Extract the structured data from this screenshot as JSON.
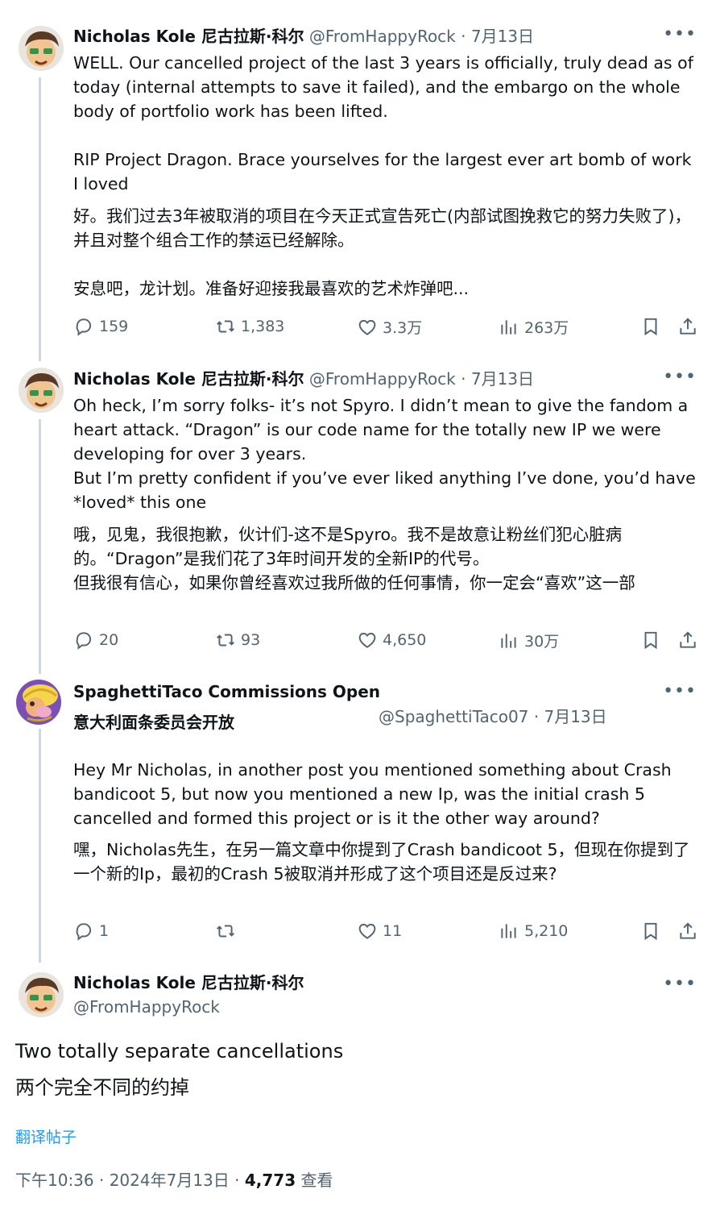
{
  "tweets": [
    {
      "author_name": "Nicholas Kole 尼古拉斯·科尔",
      "handle": "@FromHappyRock",
      "sep": "·",
      "date": "7月13日",
      "text_en": "WELL. Our cancelled project of the last 3 years is officially, truly dead as of today (internal attempts to save it failed), and the embargo on the whole body of portfolio work has been lifted.\n\nRIP Project Dragon. Brace yourselves for the largest ever art bomb of work I loved",
      "text_zh": "好。我们过去3年被取消的项目在今天正式宣告死亡(内部试图挽救它的努力失败了)，并且对整个组合工作的禁运已经解除。\n\n安息吧，龙计划。准备好迎接我最喜欢的艺术炸弹吧...",
      "replies": "159",
      "reposts": "1,383",
      "likes": "3.3万",
      "views": "263万"
    },
    {
      "author_name": "Nicholas Kole 尼古拉斯·科尔",
      "handle": "@FromHappyRock",
      "sep": "·",
      "date": "7月13日",
      "text_en": "Oh heck, I’m sorry folks- it’s not Spyro. I didn’t mean to give the fandom a heart attack. “Dragon” is our code name for the totally new IP we were developing for over 3 years.\nBut I’m pretty confident if you’ve ever liked anything I’ve done, you’d have *loved* this one",
      "text_zh": "哦，见鬼，我很抱歉，伙计们-这不是Spyro。我不是故意让粉丝们犯心脏病的。“Dragon”是我们花了3年时间开发的全新IP的代号。\n但我很有信心，如果你曾经喜欢过我所做的任何事情，你一定会“喜欢”这一部",
      "replies": "20",
      "reposts": "93",
      "likes": "4,650",
      "views": "30万"
    },
    {
      "author_name": "SpaghettiTaco Commissions Open",
      "author_name_line2": "意大利面条委员会开放",
      "handle": "@SpaghettiTaco07",
      "sep": "·",
      "date": "7月13日",
      "text_en": "Hey Mr Nicholas, in another post you mentioned something about Crash bandicoot 5, but now you mentioned a new Ip, was the initial crash 5 cancelled and formed this project or is it the other way around?",
      "text_zh": "嘿，Nicholas先生，在另一篇文章中你提到了Crash bandicoot 5，但现在你提到了一个新的Ip，最初的Crash 5被取消并形成了这个项目还是反过来?",
      "replies": "1",
      "reposts": "",
      "likes": "11",
      "views": "5,210"
    }
  ],
  "focus": {
    "author_name": "Nicholas Kole 尼古拉斯·科尔",
    "handle": "@FromHappyRock",
    "text_en": "Two totally separate cancellations",
    "text_zh": "两个完全不同的约掉",
    "translate_label": "翻译帖子",
    "timestamp": "下午10:36 · 2024年7月13日 ·",
    "views_count": "4,773",
    "views_label": "查看"
  },
  "icons": {
    "more": "more-icon",
    "reply": "reply-icon",
    "repost": "repost-icon",
    "like": "like-icon",
    "views": "views-icon",
    "bookmark": "bookmark-icon",
    "share": "share-icon"
  },
  "colors": {
    "text": "#0f1419",
    "secondary": "#536471",
    "link": "#1d9bf0",
    "thread_line": "#cfd9de"
  }
}
